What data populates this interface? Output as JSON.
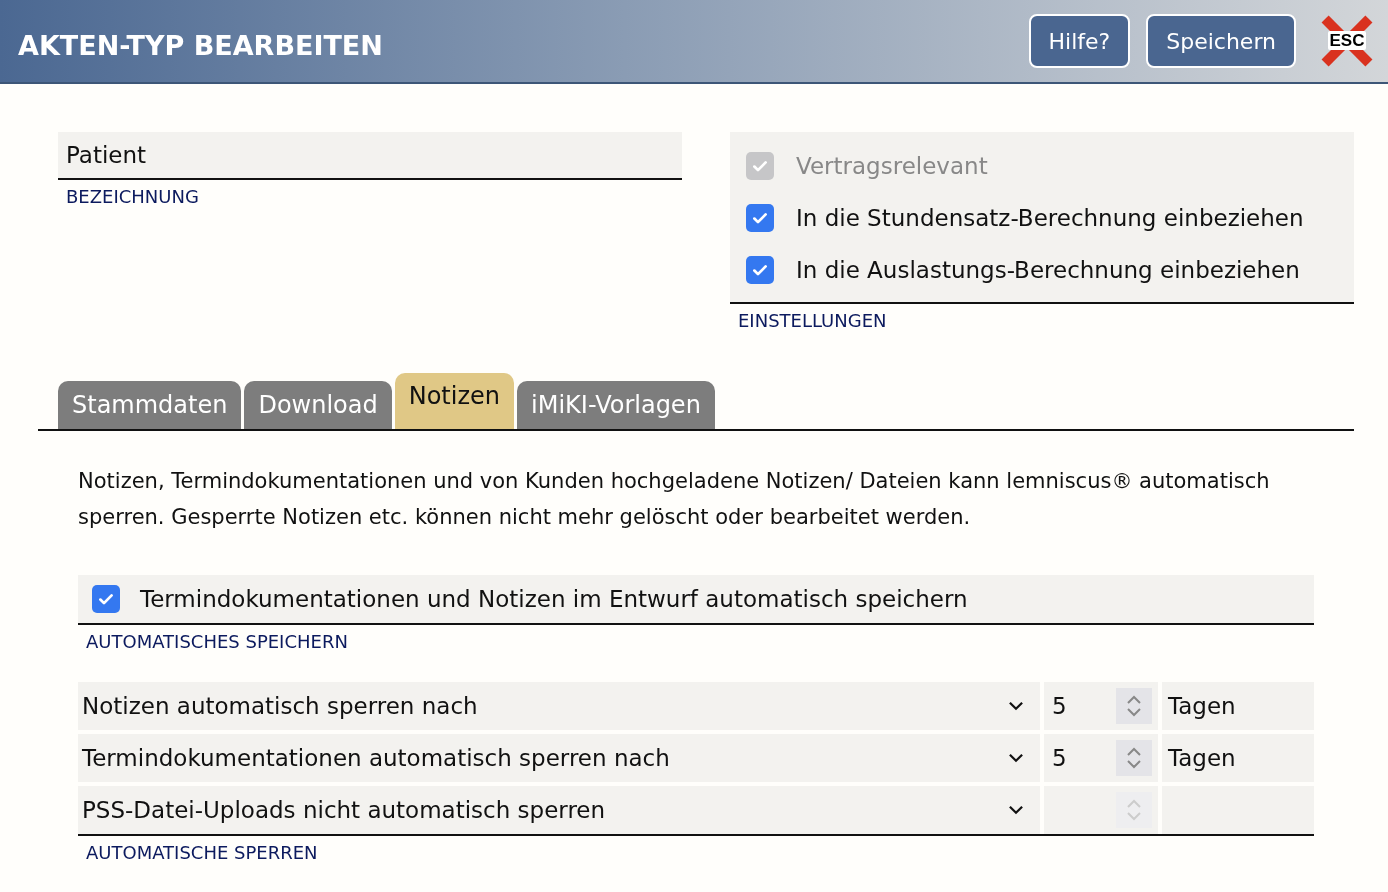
{
  "header": {
    "title": "AKTEN-TYP BEARBEITEN",
    "buttons": [
      "Hilfe?",
      "Speichern"
    ],
    "close_label": "ESC"
  },
  "name_field": {
    "value": "Patient",
    "label": "BEZEICHNUNG"
  },
  "settings": {
    "label": "EINSTELLUNGEN",
    "options": [
      {
        "label": "Vertragsrelevant",
        "checked": true,
        "disabled": true
      },
      {
        "label": "In die Stundensatz-Berechnung einbeziehen",
        "checked": true,
        "disabled": false
      },
      {
        "label": "In die Auslastungs-Berechnung einbeziehen",
        "checked": true,
        "disabled": false
      }
    ]
  },
  "tabs": [
    {
      "label": "Stammdaten",
      "selected": false
    },
    {
      "label": "Download",
      "selected": false
    },
    {
      "label": "Notizen",
      "selected": true
    },
    {
      "label": "iMiKI-Vorlagen",
      "selected": false
    }
  ],
  "description": "Notizen, Termindokumentationen und von Kunden hochgeladene Notizen/ Dateien kann lemniscus® automatisch sperren. Gesperrte Notizen etc. können nicht mehr gelöscht oder bearbeitet werden.",
  "autosave": {
    "label": "AUTOMATISCHES SPEICHERN",
    "option": {
      "label": "Termindokumentationen und Notizen im Entwurf automatisch speichern",
      "checked": true
    }
  },
  "locks": {
    "label": "AUTOMATISCHE SPERREN",
    "rows": [
      {
        "select": "Notizen automatisch sperren nach",
        "value": "5",
        "unit": "Tagen",
        "disabled": false
      },
      {
        "select": "Termindokumentationen automatisch sperren nach",
        "value": "5",
        "unit": "Tagen",
        "disabled": false
      },
      {
        "select": "PSS-Datei-Uploads nicht automatisch sperren",
        "disabled": true
      }
    ]
  }
}
